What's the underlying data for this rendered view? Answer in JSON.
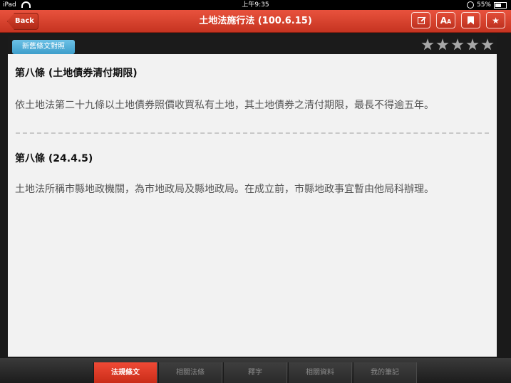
{
  "status_bar": {
    "device": "iPad",
    "time": "上午9:35",
    "battery": "55%"
  },
  "navbar": {
    "back_label": "Back",
    "title": "土地法施行法 (100.6.15)",
    "icons": [
      "edit-icon",
      "font-size-icon",
      "bookmark-icon",
      "star-icon"
    ],
    "accent_color": "#d33f2a"
  },
  "toolbar": {
    "compare_label": "新舊條文對照",
    "rating_stars": 5
  },
  "articles": [
    {
      "heading": "第八條 (土地債券清付期限)",
      "body": "依土地法第二十九條以土地債券照價收買私有土地，其土地債券之清付期限，最長不得逾五年。"
    },
    {
      "heading": "第八條 (24.4.5)",
      "body": "土地法所稱市縣地政機關，為市地政局及縣地政局。在成立前，市縣地政事宜暫由他局科辦理。"
    }
  ],
  "tabs": [
    {
      "label": "法規條文",
      "active": true
    },
    {
      "label": "相關法條",
      "active": false
    },
    {
      "label": "釋字",
      "active": false
    },
    {
      "label": "相關資料",
      "active": false
    },
    {
      "label": "我的筆記",
      "active": false
    }
  ]
}
